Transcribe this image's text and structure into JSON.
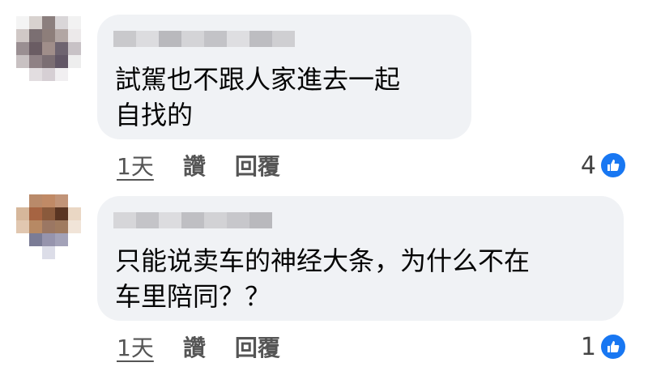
{
  "comments": [
    {
      "text_lines": [
        "試駕也不跟人家進去一起",
        "自找的"
      ],
      "time": "1天",
      "like_label": "讚",
      "reply_label": "回覆",
      "reaction_count": "4"
    },
    {
      "text_lines": [
        "只能说卖车的神经大条，为什么不在",
        "车里陪同？？"
      ],
      "time": "1天",
      "like_label": "讚",
      "reply_label": "回覆",
      "reaction_count": "1"
    }
  ],
  "colors": {
    "bubble": "#f0f2f5",
    "like_blue": "#1877f2",
    "text": "#050505",
    "meta": "#555555"
  },
  "icons": [
    "like-thumb-icon"
  ]
}
